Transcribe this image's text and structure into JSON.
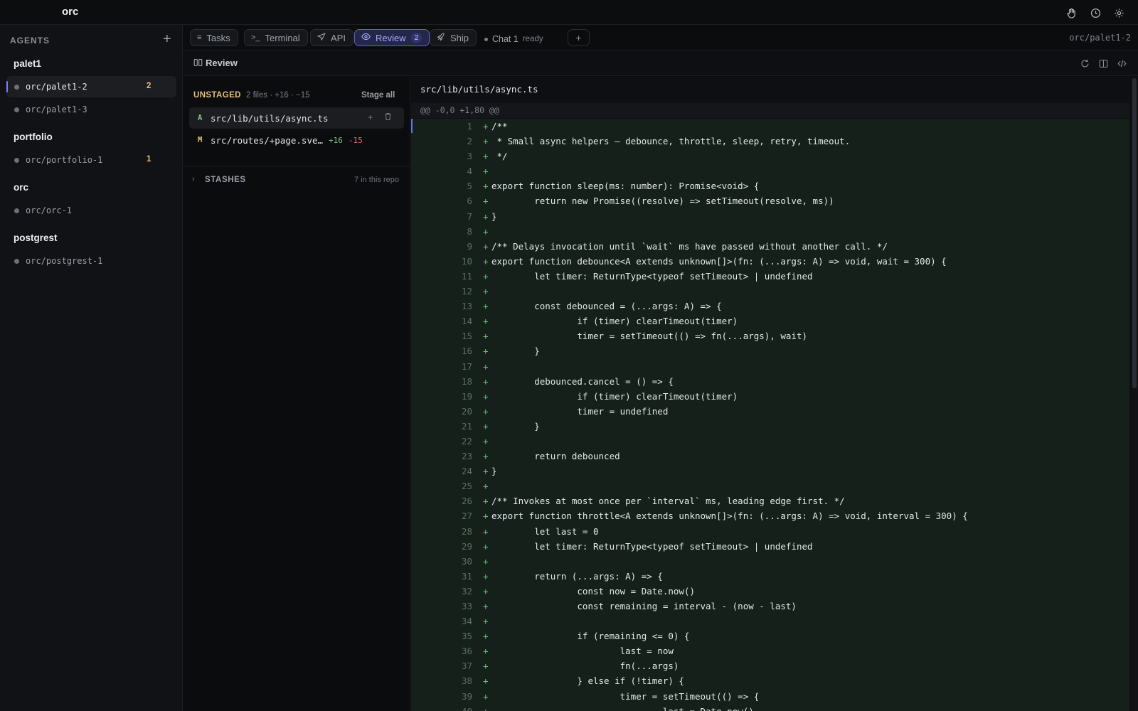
{
  "app": {
    "title": "orc"
  },
  "topbar": {
    "icons": [
      "hand-icon",
      "history-icon",
      "settings-icon"
    ]
  },
  "sidebar": {
    "header": "AGENTS",
    "add_label": "+",
    "groups": [
      {
        "name": "palet1",
        "agents": [
          {
            "label": "orc/palet1-2",
            "count": "2",
            "active": true
          },
          {
            "label": "orc/palet1-3",
            "count": ""
          }
        ]
      },
      {
        "name": "portfolio",
        "agents": [
          {
            "label": "orc/portfolio-1",
            "count": "1"
          }
        ]
      },
      {
        "name": "orc",
        "agents": [
          {
            "label": "orc/orc-1",
            "count": ""
          }
        ]
      },
      {
        "name": "postgrest",
        "agents": [
          {
            "label": "orc/postgrest-1",
            "count": ""
          }
        ]
      }
    ]
  },
  "tabs": {
    "items": [
      {
        "label": "Tasks",
        "icon": "list-icon",
        "badge": ""
      },
      {
        "label": "Terminal",
        "icon": "terminal-icon",
        "badge": ""
      },
      {
        "label": "API",
        "icon": "send-icon",
        "badge": ""
      },
      {
        "label": "Review",
        "icon": "eye-icon",
        "badge": "2",
        "active": true
      },
      {
        "label": "Ship",
        "icon": "rocket-icon",
        "badge": ""
      }
    ],
    "chat": {
      "label": "Chat 1",
      "status": "ready"
    },
    "new_tab": "+",
    "branch": "orc/palet1-2"
  },
  "review": {
    "title": "Review",
    "actions": [
      "refresh-icon",
      "split-view-icon",
      "code-icon"
    ]
  },
  "files": {
    "section": "UNSTAGED",
    "meta": "2 files · +16 · −15",
    "stage_all": "Stage all",
    "items": [
      {
        "status": "A",
        "status_color": "#7fc68a",
        "name": "src/lib/utils/async.ts",
        "adds": "",
        "dels": "",
        "active": true
      },
      {
        "status": "M",
        "status_color": "#e5c07b",
        "name": "src/routes/+page.sve…",
        "adds": "+16",
        "dels": "-15"
      }
    ],
    "stashes": {
      "label": "STASHES",
      "count": "7 in this repo"
    }
  },
  "diff": {
    "file": "src/lib/utils/async.ts",
    "hunk": "@@ -0,0 +1,80 @@",
    "lines": [
      "/**",
      " * Small async helpers — debounce, throttle, sleep, retry, timeout.",
      " */",
      "",
      "export function sleep(ms: number): Promise<void> {",
      "        return new Promise((resolve) => setTimeout(resolve, ms))",
      "}",
      "",
      "/** Delays invocation until `wait` ms have passed without another call. */",
      "export function debounce<A extends unknown[]>(fn: (...args: A) => void, wait = 300) {",
      "        let timer: ReturnType<typeof setTimeout> | undefined",
      "",
      "        const debounced = (...args: A) => {",
      "                if (timer) clearTimeout(timer)",
      "                timer = setTimeout(() => fn(...args), wait)",
      "        }",
      "",
      "        debounced.cancel = () => {",
      "                if (timer) clearTimeout(timer)",
      "                timer = undefined",
      "        }",
      "",
      "        return debounced",
      "}",
      "",
      "/** Invokes at most once per `interval` ms, leading edge first. */",
      "export function throttle<A extends unknown[]>(fn: (...args: A) => void, interval = 300) {",
      "        let last = 0",
      "        let timer: ReturnType<typeof setTimeout> | undefined",
      "",
      "        return (...args: A) => {",
      "                const now = Date.now()",
      "                const remaining = interval - (now - last)",
      "",
      "                if (remaining <= 0) {",
      "                        last = now",
      "                        fn(...args)",
      "                } else if (!timer) {",
      "                        timer = setTimeout(() => {",
      "                                last = Date.now()"
    ]
  }
}
